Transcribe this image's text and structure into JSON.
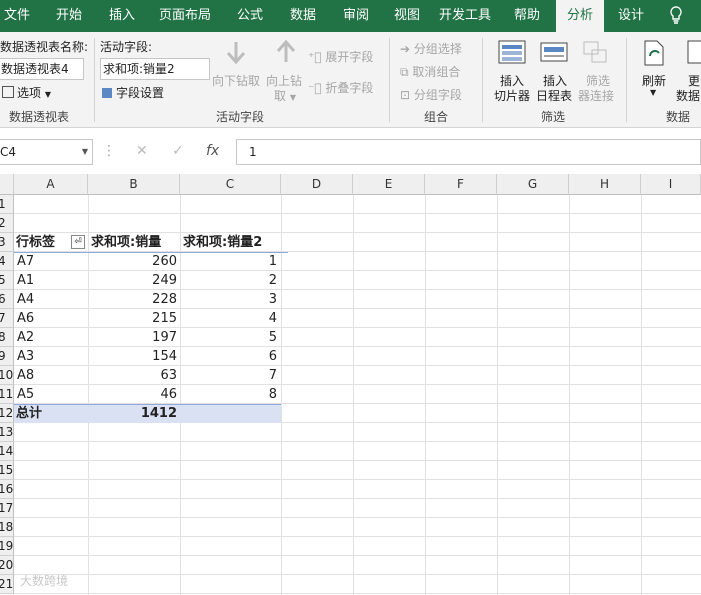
{
  "tabs": [
    "文件",
    "开始",
    "插入",
    "页面布局",
    "公式",
    "数据",
    "审阅",
    "视图",
    "开发工具",
    "帮助",
    "分析",
    "设计"
  ],
  "active_tab": "分析",
  "ribbon": {
    "pivot_name_label": "数据透视表名称:",
    "pivot_name_value": "数据透视表4",
    "options_label": "选项",
    "group_pivot": "数据透视表",
    "active_field_label": "活动字段:",
    "active_field_value": "求和项:销量2",
    "field_settings": "字段设置",
    "drill_down": "向下钻取",
    "drill_up_1": "向上钻",
    "drill_up_2": "取",
    "expand_field": "展开字段",
    "collapse_field": "折叠字段",
    "group_active_field": "活动字段",
    "group_selection": "分组选择",
    "ungroup": "取消组合",
    "group_field": "分组字段",
    "group_group": "组合",
    "insert_slicer_1": "插入",
    "insert_slicer_2": "切片器",
    "insert_timeline_1": "插入",
    "insert_timeline_2": "日程表",
    "filter_conn_1": "筛选",
    "filter_conn_2": "器连接",
    "group_filter": "筛选",
    "refresh": "刷新",
    "change_1": "更",
    "change_2": "数据",
    "group_data": "数据"
  },
  "formula_bar": {
    "name_box": "C4",
    "cancel": "✕",
    "enter": "✓",
    "fx": "fx",
    "content": "1"
  },
  "columns": [
    "A",
    "B",
    "C",
    "D",
    "E",
    "F",
    "G",
    "H",
    "I"
  ],
  "rows": [
    "1",
    "2",
    "3",
    "4",
    "5",
    "6",
    "7",
    "8",
    "9",
    "10",
    "11",
    "12",
    "13",
    "14",
    "15",
    "16",
    "17",
    "18",
    "19",
    "20",
    "21"
  ],
  "pivot": {
    "headers": [
      "行标签",
      "求和项:销量",
      "求和项:销量2"
    ],
    "rows": [
      {
        "label": "A7",
        "sales": "260",
        "rank": "1"
      },
      {
        "label": "A1",
        "sales": "249",
        "rank": "2"
      },
      {
        "label": "A4",
        "sales": "228",
        "rank": "3"
      },
      {
        "label": "A6",
        "sales": "215",
        "rank": "4"
      },
      {
        "label": "A2",
        "sales": "197",
        "rank": "5"
      },
      {
        "label": "A3",
        "sales": "154",
        "rank": "6"
      },
      {
        "label": "A8",
        "sales": "63",
        "rank": "7"
      },
      {
        "label": "A5",
        "sales": "46",
        "rank": "8"
      }
    ],
    "total_label": "总计",
    "total_value": "1412"
  },
  "watermark": "大数跨境"
}
